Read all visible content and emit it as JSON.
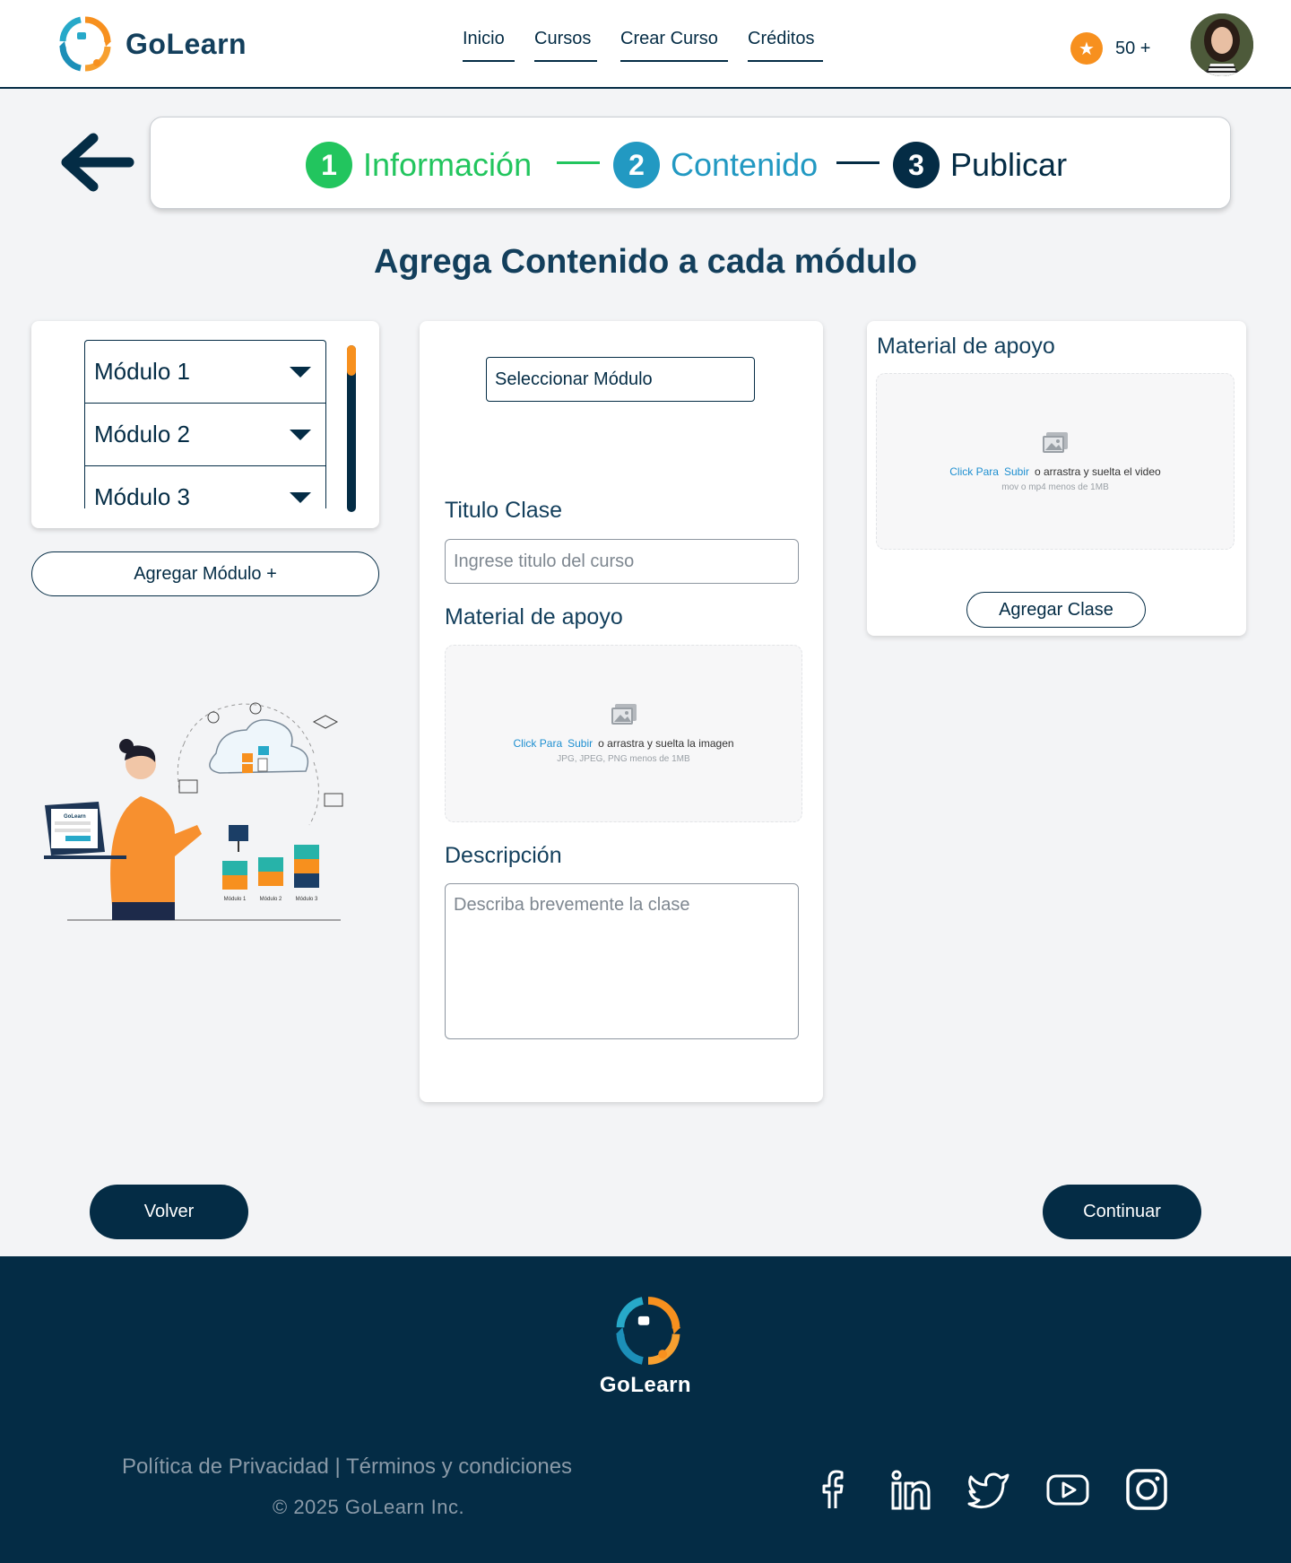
{
  "header": {
    "brand": "GoLearn",
    "nav": [
      "Inicio",
      "Cursos",
      "Crear Curso",
      "Créditos"
    ],
    "credits": "50 +",
    "icons": {
      "credits": "star-icon",
      "avatar": "user-avatar"
    }
  },
  "stepper": {
    "steps": [
      {
        "num": "1",
        "label": "Información",
        "color": "#22c55e",
        "state": "completed"
      },
      {
        "num": "2",
        "label": "Contenido",
        "color": "#2299c2",
        "state": "active"
      },
      {
        "num": "3",
        "label": "Publicar",
        "color": "#042c45",
        "state": "pending"
      }
    ]
  },
  "page_title": "Agrega Contenido a cada módulo",
  "modules": {
    "items": [
      "Módulo 1",
      "Módulo 2",
      "Módulo 3"
    ],
    "add_button": "Agregar Módulo +"
  },
  "illustration": {
    "logo_text": "GoLearn",
    "module_labels": [
      "Módulo 1",
      "Módulo 2",
      "Módulo 3"
    ]
  },
  "form": {
    "select_module": "Seleccionar Módulo",
    "title_label": "Titulo Clase",
    "title_placeholder": "Ingrese titulo del curso",
    "material_label": "Material de apoyo",
    "image_upload": {
      "link1": "Click Para",
      "link2": "Subir",
      "text": "o arrastra y suelta la imagen",
      "hint": "JPG, JPEG, PNG menos de 1MB"
    },
    "description_label": "Descripción",
    "description_placeholder": "Describa brevemente la clase"
  },
  "support": {
    "title": "Material de apoyo",
    "video_upload": {
      "link1": "Click Para",
      "link2": "Subir",
      "text": "o arrastra y suelta el video",
      "hint": "mov o mp4 menos de 1MB"
    },
    "add_button": "Agregar Clase"
  },
  "actions": {
    "back": "Volver",
    "continue": "Continuar"
  },
  "footer": {
    "brand": "GoLearn",
    "privacy": "Política de Privacidad",
    "separator": " | ",
    "terms": "Términos y condiciones",
    "copyright": "© 2025 GoLearn Inc.",
    "social": [
      "facebook-icon",
      "linkedin-icon",
      "twitter-icon",
      "youtube-icon",
      "instagram-icon"
    ]
  },
  "colors": {
    "primary": "#042c45",
    "accent": "#f7901e",
    "teal": "#2299c2",
    "green": "#22c55e",
    "background": "#f3f4f6"
  }
}
